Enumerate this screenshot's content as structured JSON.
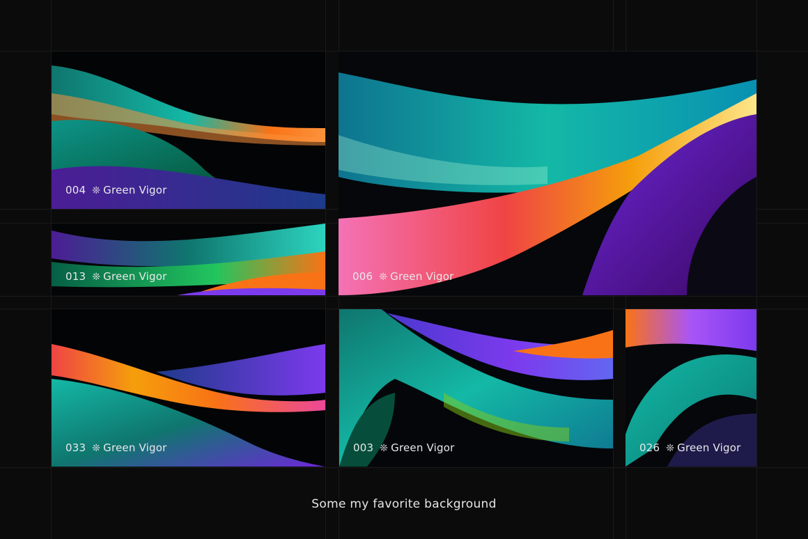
{
  "tiles": [
    {
      "number": "004",
      "separator": "❊",
      "name": "Green Vigor"
    },
    {
      "number": "013",
      "separator": "❊",
      "name": "Green Vigor"
    },
    {
      "number": "006",
      "separator": "❊",
      "name": "Green Vigor"
    },
    {
      "number": "033",
      "separator": "❊",
      "name": "Green Vigor"
    },
    {
      "number": "003",
      "separator": "❊",
      "name": "Green Vigor"
    },
    {
      "number": "026",
      "separator": "❊",
      "name": "Green Vigor"
    }
  ],
  "caption": "Some my favorite background",
  "colors": {
    "background": "#0b0b0b",
    "teal": "#14b8a6",
    "orange": "#f97316",
    "purple": "#7c3aed",
    "label": "#e9e9ea"
  }
}
